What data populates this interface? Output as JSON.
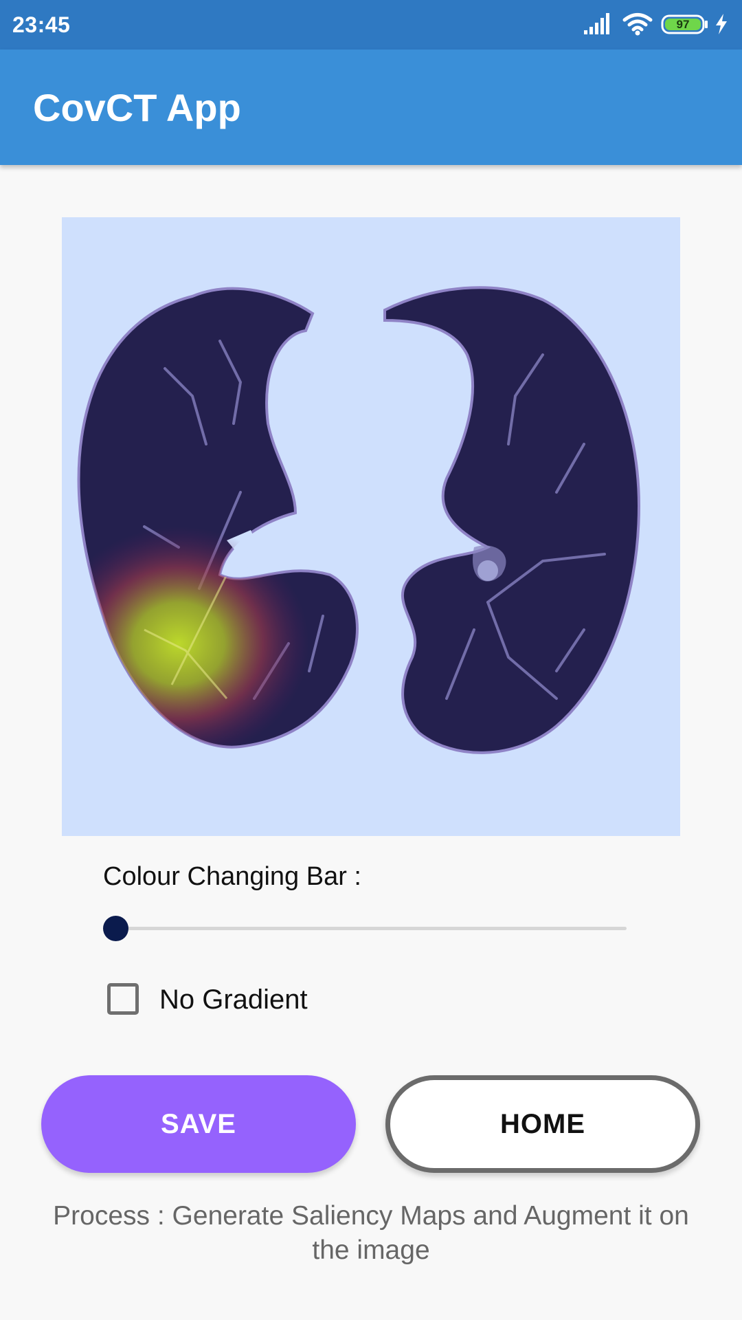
{
  "status_bar": {
    "time": "23:45",
    "battery_level": "97",
    "icons": [
      "signal-icon",
      "wifi-icon",
      "battery-icon",
      "charging-icon"
    ]
  },
  "app_bar": {
    "title": "CovCT App"
  },
  "image": {
    "icon": "lung-ct-scan-saliency-image"
  },
  "slider": {
    "label": "Colour Changing Bar :",
    "value": 0,
    "min": 0,
    "max": 100
  },
  "checkbox": {
    "label": "No Gradient",
    "checked": false
  },
  "buttons": {
    "save": "SAVE",
    "home": "HOME"
  },
  "process_text": "Process : Generate Saliency Maps and Augment it on the image",
  "colors": {
    "status_bar": "#2f79c2",
    "app_bar": "#3a8fd8",
    "save_button": "#9562fd",
    "slider_thumb": "#0b1b4d",
    "image_background": "#cfe0fd"
  }
}
